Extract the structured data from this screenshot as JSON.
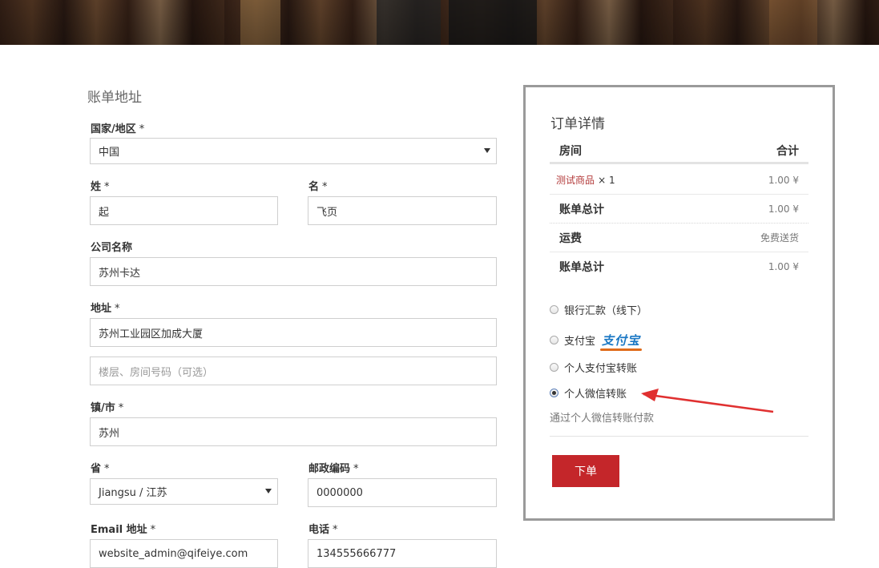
{
  "billing": {
    "title": "账单地址",
    "required_mark": "*",
    "country": {
      "label": "国家/地区",
      "value": "中国"
    },
    "last_name": {
      "label": "姓",
      "value": "起"
    },
    "first_name": {
      "label": "名",
      "value": "飞页"
    },
    "company": {
      "label": "公司名称",
      "value": "苏州卡达"
    },
    "address": {
      "label": "地址",
      "line1": "苏州工业园区加成大厦",
      "line2_placeholder": "楼层、房间号码（可选）"
    },
    "city": {
      "label": "镇/市",
      "value": "苏州"
    },
    "province": {
      "label": "省",
      "value": "Jiangsu / 江苏"
    },
    "postcode": {
      "label": "邮政编码",
      "value": "0000000"
    },
    "email": {
      "label": "Email 地址",
      "value": "website_admin@qifeiye.com"
    },
    "phone": {
      "label": "电话",
      "value": "134555666777"
    }
  },
  "order": {
    "title": "订单详情",
    "col_product": "房间",
    "col_total": "合计",
    "item": {
      "name": "测试商品",
      "qty": "× 1",
      "price": "1.00 ¥"
    },
    "subtotal": {
      "label": "账单总计",
      "value": "1.00 ¥"
    },
    "shipping": {
      "label": "运费",
      "value": "免费送货"
    },
    "total": {
      "label": "账单总计",
      "value": "1.00 ¥"
    }
  },
  "payment": {
    "options": [
      "银行汇款（线下）",
      "支付宝",
      "个人支付宝转账",
      "个人微信转账"
    ],
    "alipay_logo": "支付宝",
    "selected": "个人微信转账",
    "description": "通过个人微信转账付款",
    "place_order_label": "下单",
    "arrow_color": "#e03030"
  }
}
